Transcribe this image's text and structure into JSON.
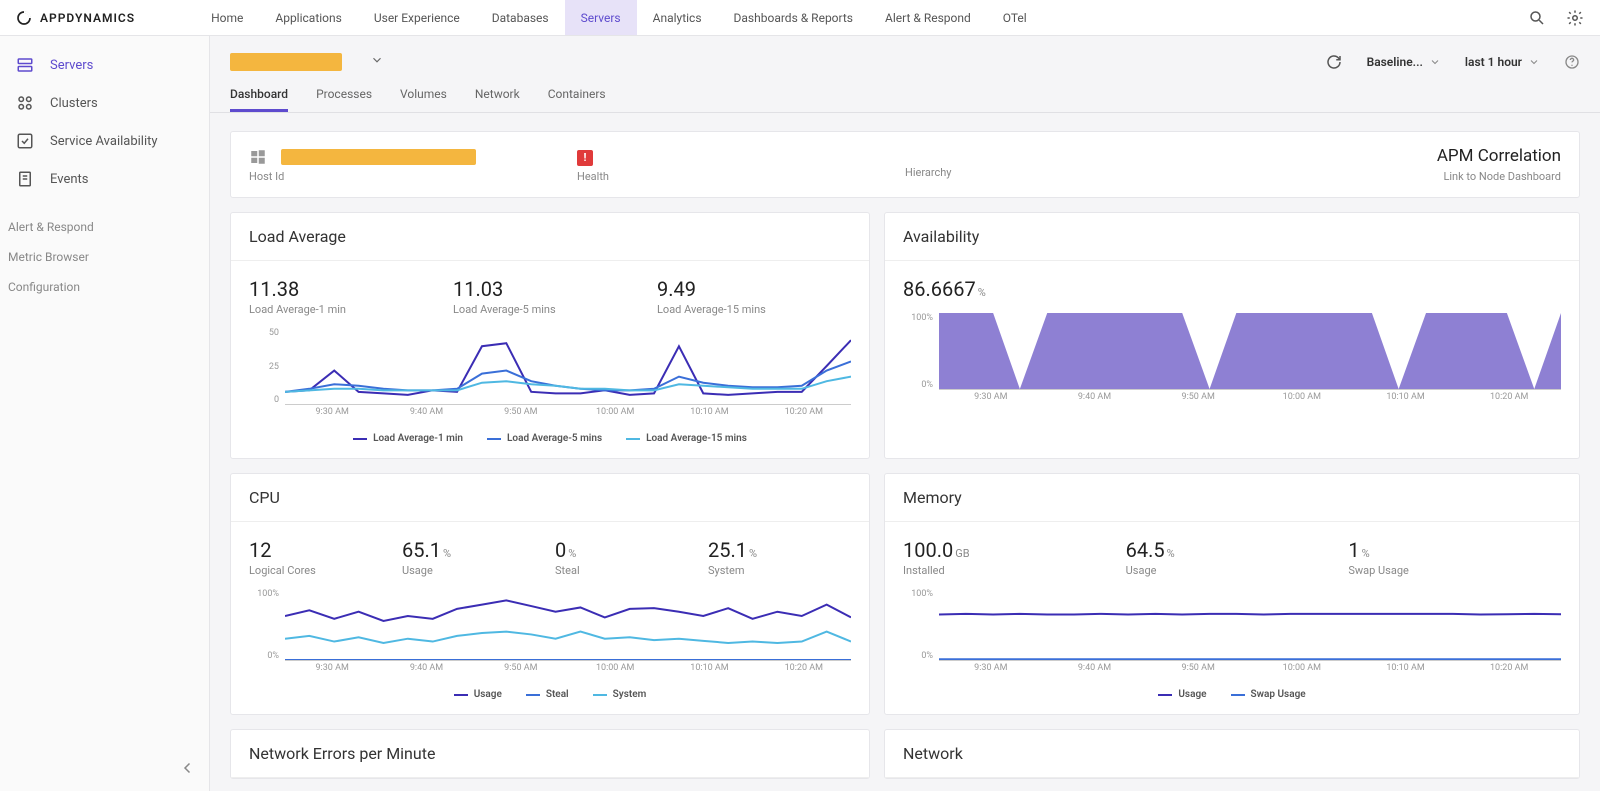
{
  "brand": "APPDYNAMICS",
  "topnav": [
    "Home",
    "Applications",
    "User Experience",
    "Databases",
    "Servers",
    "Analytics",
    "Dashboards & Reports",
    "Alert & Respond",
    "OTel"
  ],
  "topnav_active": 4,
  "sidebar": {
    "items": [
      {
        "label": "Servers",
        "icon": "servers",
        "active": true
      },
      {
        "label": "Clusters",
        "icon": "clusters"
      },
      {
        "label": "Service Availability",
        "icon": "check-square"
      },
      {
        "label": "Events",
        "icon": "document"
      }
    ],
    "subs": [
      "Alert & Respond",
      "Metric Browser",
      "Configuration"
    ]
  },
  "subheader": {
    "refresh": "↻",
    "baseline_label": "Baseline...",
    "time_label": "last 1 hour"
  },
  "tabs": [
    "Dashboard",
    "Processes",
    "Volumes",
    "Network",
    "Containers"
  ],
  "tabs_active": 0,
  "info": {
    "host_label": "Host Id",
    "health_label": "Health",
    "hierarchy_label": "Hierarchy",
    "apm_title": "APM Correlation",
    "apm_link": "Link to Node Dashboard"
  },
  "load_panel": {
    "title": "Load Average",
    "stats": [
      {
        "value": "11.38",
        "label": "Load Average-1 min"
      },
      {
        "value": "11.03",
        "label": "Load Average-5 mins"
      },
      {
        "value": "9.49",
        "label": "Load Average-15 mins"
      }
    ],
    "y_ticks": [
      "50",
      "25",
      "0"
    ],
    "x_ticks": [
      "9:30 AM",
      "9:40 AM",
      "9:50 AM",
      "10:00 AM",
      "10:10 AM",
      "10:20 AM"
    ],
    "legend": [
      {
        "label": "Load Average-1 min",
        "color": "#3b2db4"
      },
      {
        "label": "Load Average-5 mins",
        "color": "#3a6fd8"
      },
      {
        "label": "Load Average-15 mins",
        "color": "#4fb8e2"
      }
    ]
  },
  "avail_panel": {
    "title": "Availability",
    "value": "86.6667",
    "unit": "%",
    "y_ticks": [
      "100%",
      "0%"
    ],
    "x_ticks": [
      "9:30 AM",
      "9:40 AM",
      "9:50 AM",
      "10:00 AM",
      "10:10 AM",
      "10:20 AM"
    ]
  },
  "cpu_panel": {
    "title": "CPU",
    "stats": [
      {
        "value": "12",
        "unit": "",
        "label": "Logical Cores"
      },
      {
        "value": "65.1",
        "unit": "%",
        "label": "Usage"
      },
      {
        "value": "0",
        "unit": "%",
        "label": "Steal"
      },
      {
        "value": "25.1",
        "unit": "%",
        "label": "System"
      }
    ],
    "y_ticks": [
      "100%",
      "0%"
    ],
    "x_ticks": [
      "9:30 AM",
      "9:40 AM",
      "9:50 AM",
      "10:00 AM",
      "10:10 AM",
      "10:20 AM"
    ],
    "legend": [
      {
        "label": "Usage",
        "color": "#3b2db4"
      },
      {
        "label": "Steal",
        "color": "#3a6fd8"
      },
      {
        "label": "System",
        "color": "#4fb8e2"
      }
    ]
  },
  "mem_panel": {
    "title": "Memory",
    "stats": [
      {
        "value": "100.0",
        "unit": "GB",
        "label": "Installed"
      },
      {
        "value": "64.5",
        "unit": "%",
        "label": "Usage"
      },
      {
        "value": "1",
        "unit": "%",
        "label": "Swap Usage"
      }
    ],
    "y_ticks": [
      "100%",
      "0%"
    ],
    "x_ticks": [
      "9:30 AM",
      "9:40 AM",
      "9:50 AM",
      "10:00 AM",
      "10:10 AM",
      "10:20 AM"
    ],
    "legend": [
      {
        "label": "Usage",
        "color": "#3b2db4"
      },
      {
        "label": "Swap Usage",
        "color": "#3a6fd8"
      }
    ]
  },
  "net_err_panel": {
    "title": "Network Errors per Minute"
  },
  "net_panel": {
    "title": "Network"
  },
  "chart_data": [
    {
      "type": "line",
      "title": "Load Average",
      "ylim": [
        0,
        50
      ],
      "x_categories": [
        "9:30 AM",
        "9:40 AM",
        "9:50 AM",
        "10:00 AM",
        "10:10 AM",
        "10:20 AM"
      ],
      "series": [
        {
          "name": "Load Average-1 min",
          "color": "#3b2db4",
          "values": [
            8,
            9,
            22,
            8,
            7,
            6,
            9,
            8,
            38,
            40,
            8,
            7,
            7,
            9,
            6,
            7,
            38,
            7,
            6,
            7,
            8,
            8,
            25,
            42
          ]
        },
        {
          "name": "Load Average-5 mins",
          "color": "#3a6fd8",
          "values": [
            8,
            10,
            13,
            12,
            10,
            9,
            9,
            10,
            20,
            22,
            15,
            12,
            10,
            9,
            9,
            10,
            18,
            14,
            12,
            11,
            11,
            12,
            22,
            28
          ]
        },
        {
          "name": "Load Average-15 mins",
          "color": "#4fb8e2",
          "values": [
            8,
            9,
            10,
            10,
            9,
            9,
            9,
            9,
            14,
            15,
            13,
            12,
            10,
            10,
            9,
            9,
            13,
            12,
            11,
            10,
            10,
            10,
            15,
            18
          ]
        }
      ]
    },
    {
      "type": "area",
      "title": "Availability",
      "ylim": [
        0,
        100
      ],
      "x_categories": [
        "9:30 AM",
        "9:40 AM",
        "9:50 AM",
        "10:00 AM",
        "10:10 AM",
        "10:20 AM"
      ],
      "series": [
        {
          "name": "Availability %",
          "color": "#7a6acb",
          "values": [
            100,
            100,
            100,
            0,
            100,
            100,
            100,
            100,
            100,
            100,
            0,
            100,
            100,
            100,
            100,
            100,
            100,
            0,
            100,
            100,
            100,
            100,
            0,
            100
          ]
        }
      ]
    },
    {
      "type": "line",
      "title": "CPU",
      "ylim": [
        0,
        100
      ],
      "x_categories": [
        "9:30 AM",
        "9:40 AM",
        "9:50 AM",
        "10:00 AM",
        "10:10 AM",
        "10:20 AM"
      ],
      "series": [
        {
          "name": "Usage",
          "color": "#3b2db4",
          "values": [
            62,
            70,
            58,
            68,
            55,
            62,
            58,
            72,
            78,
            84,
            76,
            68,
            74,
            60,
            72,
            73,
            68,
            62,
            73,
            58,
            68,
            62,
            78,
            60
          ]
        },
        {
          "name": "Steal",
          "color": "#3a6fd8",
          "values": [
            0,
            0,
            0,
            0,
            0,
            0,
            0,
            0,
            0,
            0,
            0,
            0,
            0,
            0,
            0,
            0,
            0,
            0,
            0,
            0,
            0,
            0,
            0,
            0
          ]
        },
        {
          "name": "System",
          "color": "#4fb8e2",
          "values": [
            30,
            34,
            26,
            32,
            24,
            30,
            26,
            34,
            38,
            40,
            36,
            30,
            40,
            30,
            32,
            28,
            30,
            27,
            24,
            26,
            24,
            26,
            40,
            26
          ]
        }
      ]
    },
    {
      "type": "line",
      "title": "Memory",
      "ylim": [
        0,
        100
      ],
      "x_categories": [
        "9:30 AM",
        "9:40 AM",
        "9:50 AM",
        "10:00 AM",
        "10:10 AM",
        "10:20 AM"
      ],
      "series": [
        {
          "name": "Usage",
          "color": "#3b2db4",
          "values": [
            64,
            65,
            64,
            65,
            64,
            64,
            65,
            64,
            65,
            64,
            65,
            65,
            64,
            65,
            65,
            65,
            65,
            65,
            65,
            65,
            64,
            64.5,
            65,
            64.5
          ]
        },
        {
          "name": "Swap Usage",
          "color": "#3a6fd8",
          "values": [
            1,
            1,
            1,
            1,
            1,
            1,
            1,
            1,
            1,
            1,
            1,
            1,
            1,
            1,
            1,
            1,
            1,
            1,
            1,
            1,
            1,
            1,
            1,
            1
          ]
        }
      ]
    }
  ]
}
